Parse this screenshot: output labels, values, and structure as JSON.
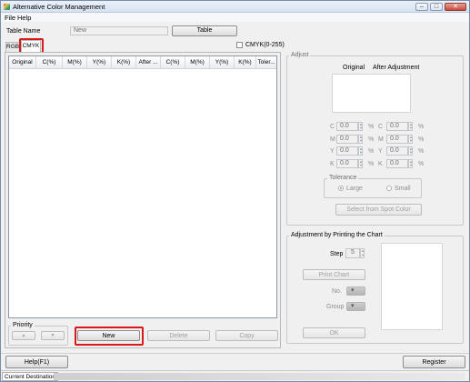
{
  "window": {
    "title": "Alternative Color Management"
  },
  "menu": {
    "file": "File",
    "help": "Help"
  },
  "table_name": {
    "label": "Table Name",
    "value": "New",
    "table_button": "Table"
  },
  "tabs": [
    {
      "label": "RGB"
    },
    {
      "label": "CMYK",
      "selected": true
    }
  ],
  "cmyk_option": {
    "label": "CMYK(0-255)",
    "checked": false
  },
  "color_table": {
    "columns": [
      "Original",
      "C(%)",
      "M(%)",
      "Y(%)",
      "K(%)",
      "After ...",
      "C(%)",
      "M(%)",
      "Y(%)",
      "K(%)",
      "Toler..."
    ],
    "rows": []
  },
  "adjust": {
    "title": "Adjust",
    "original_label": "Original",
    "after_label": "After Adjustment",
    "fields": [
      {
        "name": "C",
        "original": "0.0",
        "after": "0.0",
        "unit": "%"
      },
      {
        "name": "M",
        "original": "0.0",
        "after": "0.0",
        "unit": "%"
      },
      {
        "name": "Y",
        "original": "0.0",
        "after": "0.0",
        "unit": "%"
      },
      {
        "name": "K",
        "original": "0.0",
        "after": "0.0",
        "unit": "%"
      }
    ],
    "tolerance": {
      "title": "Tolerance",
      "options": [
        "Large",
        "Small"
      ],
      "selected": "Large"
    },
    "spot_color_button": "Select from Spot Color"
  },
  "chart_adjust": {
    "title": "Adjustment by Printing the Chart",
    "step_label": "Step",
    "step_value": "5",
    "print_button": "Print Chart",
    "no_label": "No.",
    "group_label": "Group",
    "ok_button": "OK"
  },
  "priority": {
    "title": "Priority",
    "up": "▲",
    "down": "▼"
  },
  "actions": {
    "new": "New",
    "delete": "Delete",
    "copy": "Copy"
  },
  "footer": {
    "help": "Help(F1)",
    "register": "Register"
  },
  "status": {
    "destination": "Current Destination"
  },
  "colors": {
    "highlight": "#d7191c",
    "title_bar": "#d6e2f2",
    "window_bg": "#f0f0f0"
  }
}
